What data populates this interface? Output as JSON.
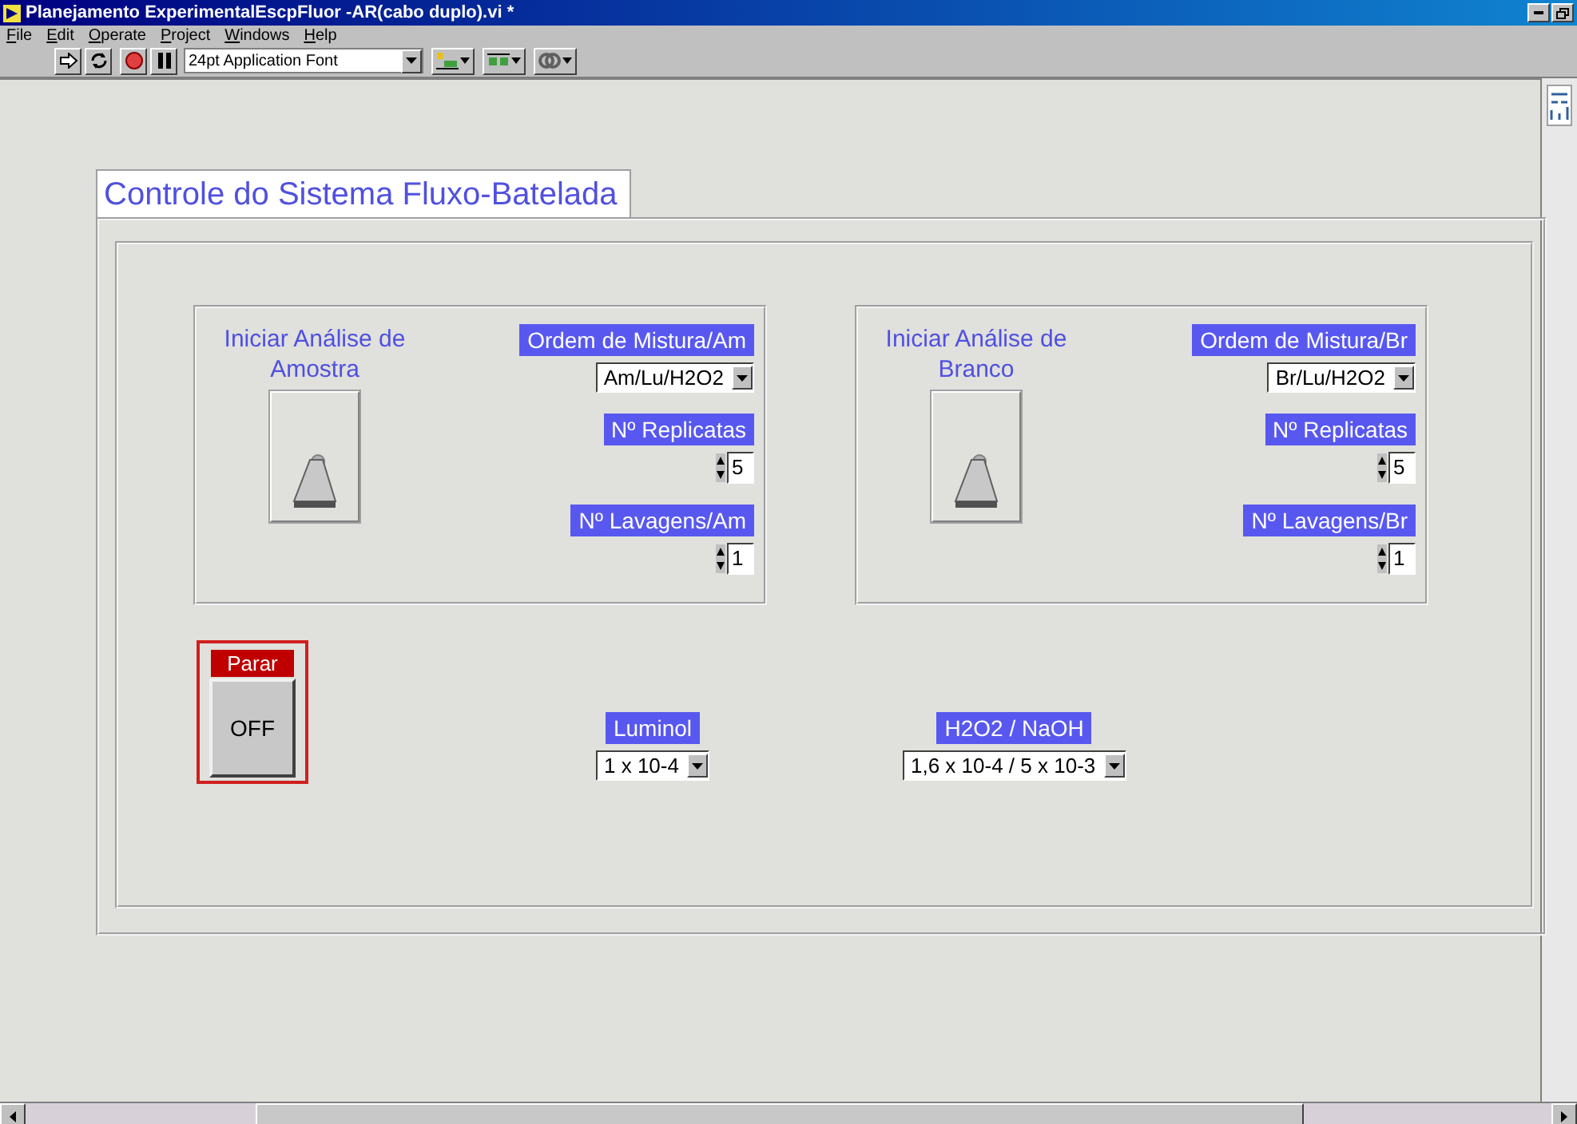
{
  "window": {
    "title": "Planejamento ExperimentalEscpFluor -AR(cabo duplo).vi *"
  },
  "menu": [
    "File",
    "Edit",
    "Operate",
    "Project",
    "Windows",
    "Help"
  ],
  "toolbar": {
    "font": "24pt Application Font"
  },
  "panel_title": "Controle do Sistema Fluxo-Batelada",
  "sections": [
    {
      "caption": "Iniciar Análise de Amostra",
      "switch_on": false,
      "order_label": "Ordem de Mistura/Am",
      "order_value": "Am/Lu/H2O2",
      "replicates_label": "Nº Replicatas",
      "replicates_value": "5",
      "washes_label": "Nº Lavagens/Am",
      "washes_value": "1"
    },
    {
      "caption": "Iniciar Análise de Branco",
      "switch_on": false,
      "order_label": "Ordem de Mistura/Br",
      "order_value": "Br/Lu/H2O2",
      "replicates_label": "Nº Replicatas",
      "replicates_value": "5",
      "washes_label": "Nº Lavagens/Br",
      "washes_value": "1"
    }
  ],
  "stop": {
    "label": "Parar",
    "button": "OFF",
    "on": false
  },
  "luminol": {
    "label": "Luminol",
    "value": "1 x 10-4"
  },
  "h2o2_naoh": {
    "label": "H2O2 / NaOH",
    "value": "1,6 x 10-4 / 5 x 10-3"
  }
}
